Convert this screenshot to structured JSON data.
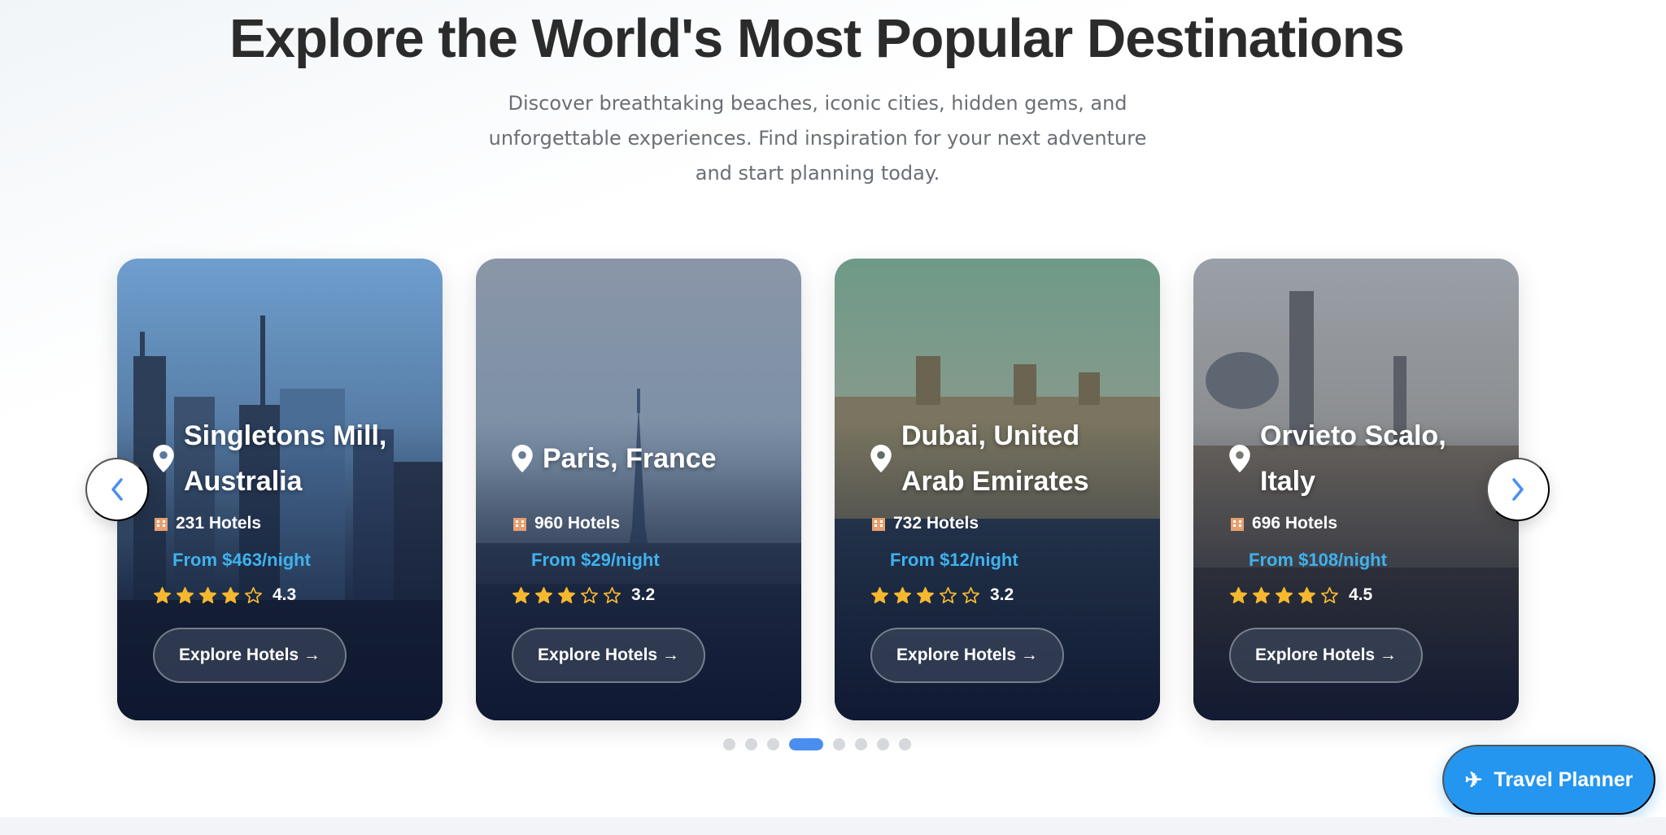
{
  "hero": {
    "title": "Explore the World's Most Popular Destinations",
    "subtitle": "Discover breathtaking beaches, iconic cities, hidden gems, and unforgettable experiences. Find inspiration for your next adventure and start planning today."
  },
  "carousel": {
    "prev_icon": "chevron-left-icon",
    "next_icon": "chevron-right-icon",
    "cards": [
      {
        "location": "Singletons Mill, Australia",
        "hotels": "231 Hotels",
        "price": "From $463/night",
        "rating_value": 4.3,
        "rating_text": "4.3",
        "stars_filled": 4,
        "button": "Explore Hotels →"
      },
      {
        "location": "Paris, France",
        "hotels": "960 Hotels",
        "price": "From $29/night",
        "rating_value": 3.2,
        "rating_text": "3.2",
        "stars_filled": 3,
        "button": "Explore Hotels →"
      },
      {
        "location": "Dubai, United Arab Emirates",
        "hotels": "732 Hotels",
        "price": "From $12/night",
        "rating_value": 3.2,
        "rating_text": "3.2",
        "stars_filled": 3,
        "button": "Explore Hotels →"
      },
      {
        "location": "Orvieto Scalo, Italy",
        "hotels": "696 Hotels",
        "price": "From $108/night",
        "rating_value": 4.5,
        "rating_text": "4.5",
        "stars_filled": 4,
        "button": "Explore Hotels →"
      }
    ],
    "pagination": {
      "total": 8,
      "active": 4
    }
  },
  "travel_planner": {
    "label": "Travel Planner",
    "icon": "airplane-icon"
  },
  "colors": {
    "accent": "#2596ef",
    "price": "#3fb2ee",
    "star": "#f5b82e",
    "dot_active": "#4a8ff0"
  }
}
